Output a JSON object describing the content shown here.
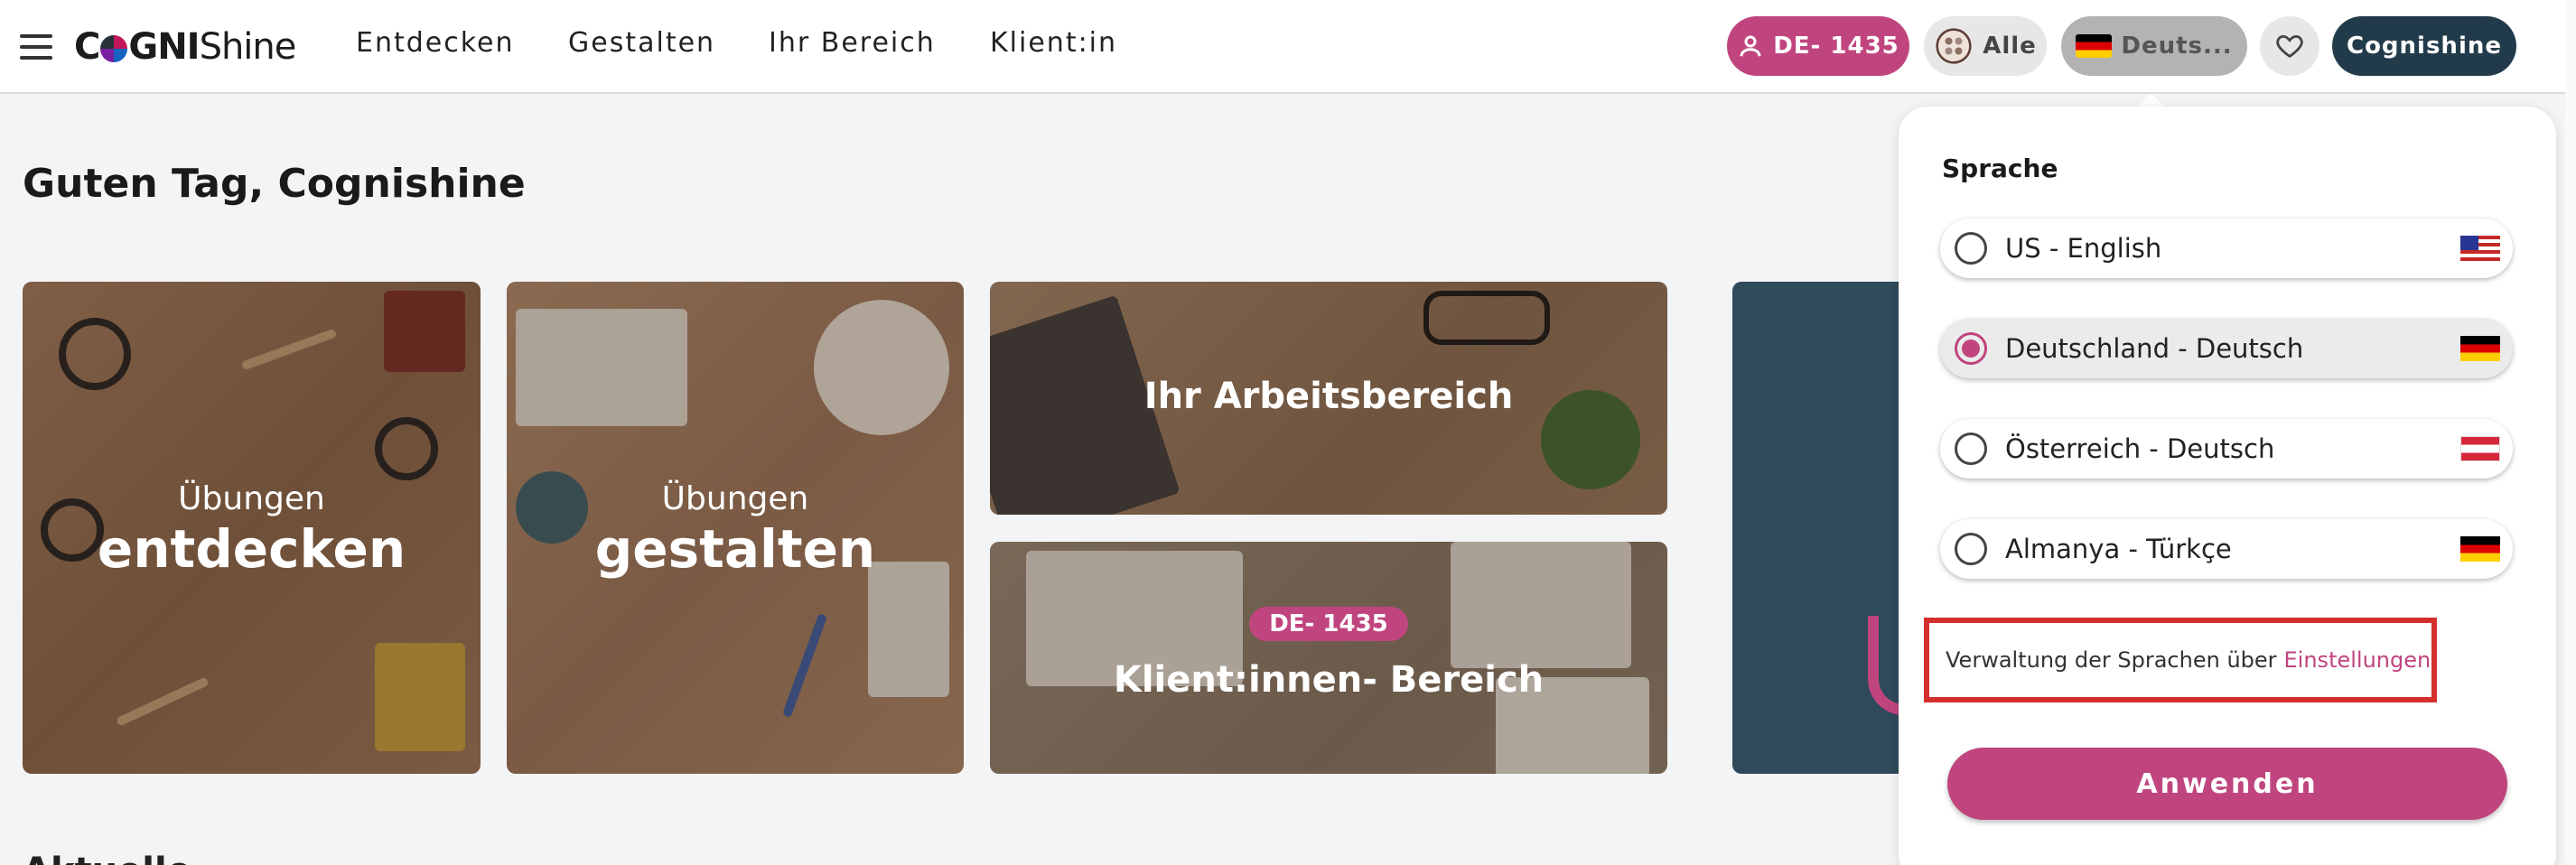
{
  "header": {
    "logo": {
      "part1": "C",
      "part2": "GNI",
      "part3": "Shine"
    },
    "nav": [
      "Entdecken",
      "Gestalten",
      "Ihr Bereich",
      "Klient:in"
    ],
    "client_badge": "DE- 1435",
    "filter_label": "Alle",
    "language_label": "Deuts...",
    "user_label": "Cognishine"
  },
  "main": {
    "greeting": "Guten Tag, Cognishine",
    "tiles": [
      {
        "small": "Übungen",
        "big": "entdecken"
      },
      {
        "small": "Übungen",
        "big": "gestalten"
      },
      {
        "big": "Ihr Arbeitsbereich"
      },
      {
        "badge": "DE- 1435",
        "big": "Klient:innen- Bereich"
      }
    ],
    "section_peek": "Aktuelle Empfehlungen"
  },
  "language_dropdown": {
    "title": "Sprache",
    "options": [
      {
        "label": "US - English",
        "flag": "us-flag-icon",
        "selected": false
      },
      {
        "label": "Deutschland - Deutsch",
        "flag": "de-flag-icon",
        "selected": true
      },
      {
        "label": "Österreich - Deutsch",
        "flag": "at-flag-icon",
        "selected": false
      },
      {
        "label": "Almanya - Türkçe",
        "flag": "de-flag-icon",
        "selected": false
      }
    ],
    "manage_text": "Verwaltung der Sprachen über",
    "manage_link": "Einstellungen",
    "apply_label": "Anwenden"
  },
  "colors": {
    "accent": "#c0457f",
    "dark_navy": "#223b4a",
    "highlight_box": "#d32f2f"
  }
}
